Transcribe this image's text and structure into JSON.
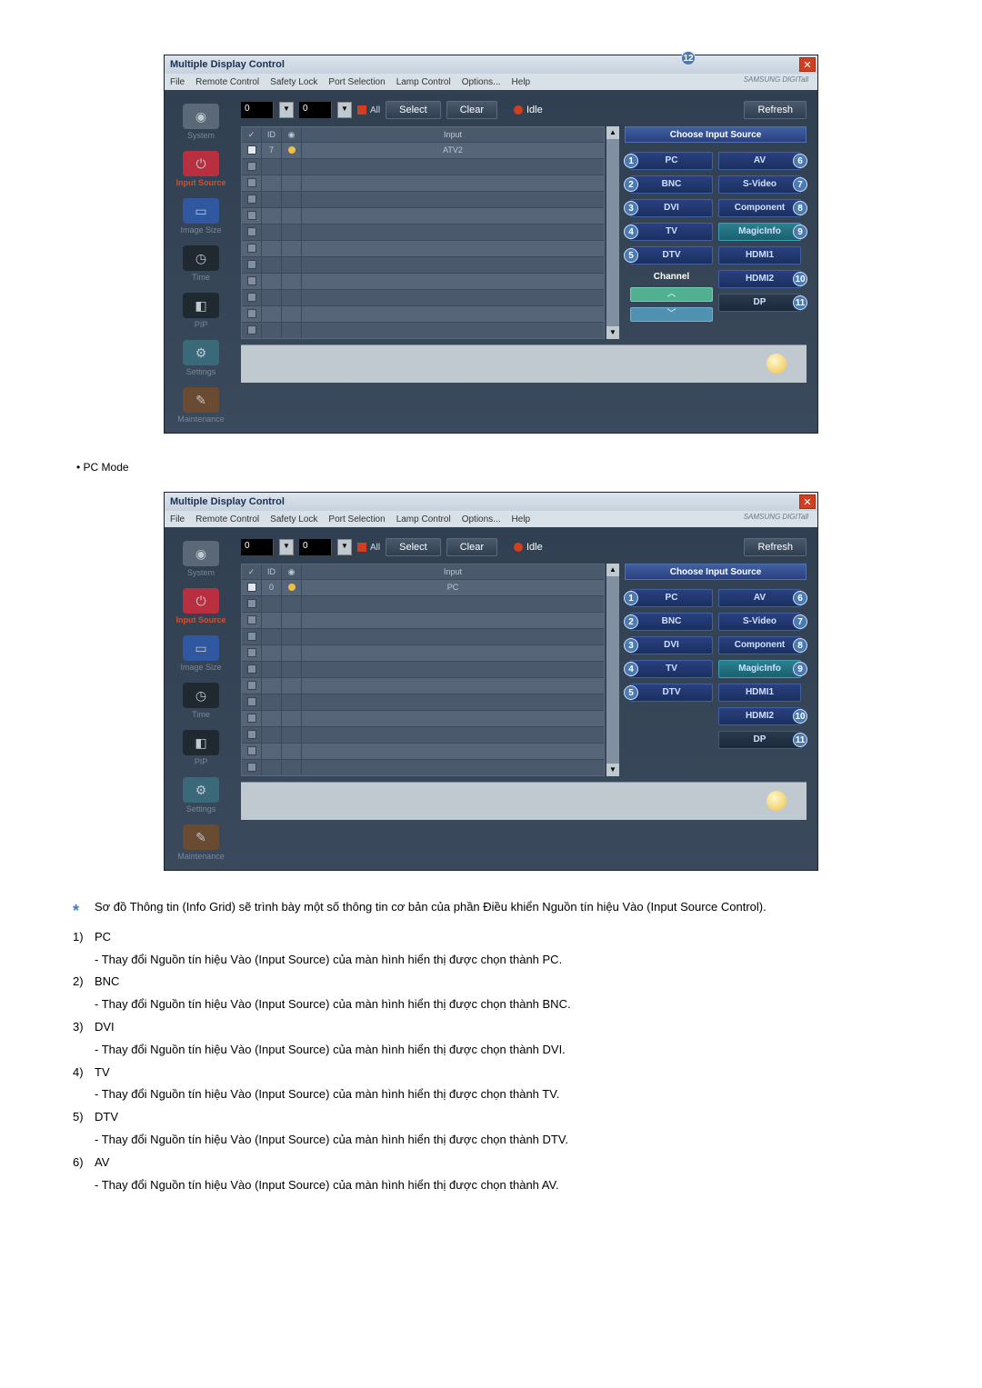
{
  "window": {
    "title": "Multiple Display Control",
    "brand": "SAMSUNG DIGITall"
  },
  "menubar": {
    "file": "File",
    "remote": "Remote Control",
    "safety": "Safety Lock",
    "port": "Port Selection",
    "lamp": "Lamp Control",
    "options": "Options...",
    "help": "Help"
  },
  "top": {
    "dd1": "0",
    "dd2": "0",
    "all": "All",
    "select": "Select",
    "clear": "Clear",
    "idle": "Idle",
    "refresh": "Refresh"
  },
  "sidebar": {
    "system": "System",
    "power": "——",
    "input_source": "Input Source",
    "image_size": "Image Size",
    "time": "Time",
    "pip": "PIP",
    "settings": "Settings",
    "maintenance": "Maintenance"
  },
  "grid": {
    "head_chk": "✓",
    "head_id": "ID",
    "head_dot": "•",
    "head_input": "Input",
    "row1_id": "7",
    "row1_input": "ATV2",
    "row2_id": "0",
    "row2_input": "PC"
  },
  "panel": {
    "title": "Choose Input Source",
    "left": [
      "PC",
      "BNC",
      "DVI",
      "TV",
      "DTV"
    ],
    "right": [
      "AV",
      "S-Video",
      "Component",
      "MagicInfo",
      "HDMI1",
      "HDMI2",
      "DP"
    ],
    "left_nums": [
      "1",
      "2",
      "3",
      "4",
      "5"
    ],
    "right_nums": [
      "6",
      "7",
      "8",
      "9",
      "10",
      "11"
    ],
    "channel": "Channel",
    "channel_num": "12"
  },
  "mode": "• PC Mode",
  "notes": {
    "star_text": "Sơ đồ Thông tin (Info Grid) sẽ trình bày một số thông tin cơ bản của phần Điều khiển Nguồn tín hiệu Vào (Input Source Control).",
    "items": [
      {
        "num": "1)",
        "title": "PC",
        "desc": "- Thay đổi Nguồn tín hiệu Vào (Input Source) của màn hình hiển thị được chọn thành PC."
      },
      {
        "num": "2)",
        "title": "BNC",
        "desc": "- Thay đổi Nguồn tín hiệu Vào (Input Source) của màn hình hiển thị được chọn thành BNC."
      },
      {
        "num": "3)",
        "title": "DVI",
        "desc": "- Thay đổi Nguồn tín hiệu Vào (Input Source) của màn hình hiển thị được chọn thành DVI."
      },
      {
        "num": "4)",
        "title": "TV",
        "desc": "- Thay đổi Nguồn tín hiệu Vào (Input Source) của màn hình hiển thị được chọn thành TV."
      },
      {
        "num": "5)",
        "title": "DTV",
        "desc": "- Thay đổi Nguồn tín hiệu Vào (Input Source) của màn hình hiển thị được chọn thành DTV."
      },
      {
        "num": "6)",
        "title": "AV",
        "desc": "- Thay đổi Nguồn tín hiệu Vào (Input Source) của màn hình hiển thị được chọn thành AV."
      }
    ]
  }
}
